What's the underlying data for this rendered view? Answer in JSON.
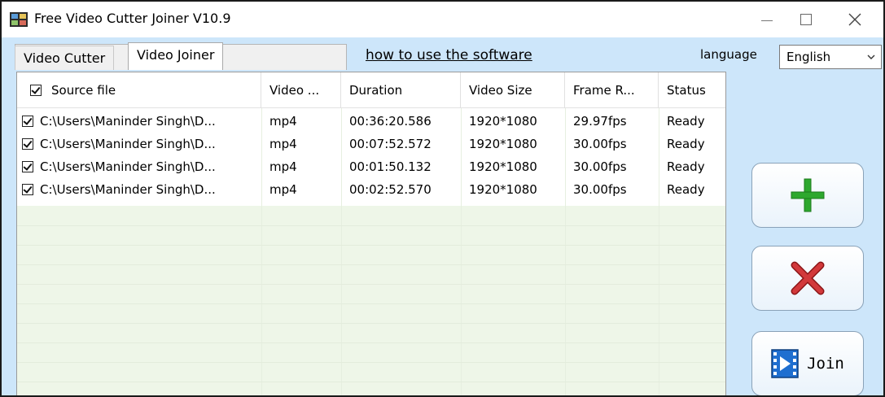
{
  "window": {
    "title": "Free Video Cutter Joiner V10.9",
    "controls": {
      "minimize": "—",
      "maximize": "☐",
      "close": "✕"
    }
  },
  "tabs": [
    {
      "label": "Video Cutter",
      "active": false
    },
    {
      "label": "Video Joiner",
      "active": true
    }
  ],
  "howto_link": "how to use the software",
  "language": {
    "label": "language",
    "selected": "English"
  },
  "table": {
    "columns": [
      "Source file",
      "Video ...",
      "Duration",
      "Video Size",
      "Frame R...",
      "Status"
    ],
    "header_checked": true,
    "rows": [
      {
        "checked": true,
        "source": "C:\\Users\\Maninder Singh\\D...",
        "format": "mp4",
        "duration": "00:36:20.586",
        "size": "1920*1080",
        "frame_rate": "29.97fps",
        "status": "Ready"
      },
      {
        "checked": true,
        "source": "C:\\Users\\Maninder Singh\\D...",
        "format": "mp4",
        "duration": "00:07:52.572",
        "size": "1920*1080",
        "frame_rate": "30.00fps",
        "status": "Ready"
      },
      {
        "checked": true,
        "source": "C:\\Users\\Maninder Singh\\D...",
        "format": "mp4",
        "duration": "00:01:50.132",
        "size": "1920*1080",
        "frame_rate": "30.00fps",
        "status": "Ready"
      },
      {
        "checked": true,
        "source": "C:\\Users\\Maninder Singh\\D...",
        "format": "mp4",
        "duration": "00:02:52.570",
        "size": "1920*1080",
        "frame_rate": "30.00fps",
        "status": "Ready"
      }
    ]
  },
  "buttons": {
    "add_icon": "plus-icon",
    "remove_icon": "x-icon",
    "join_icon": "film-play-icon",
    "join_label": "Join"
  },
  "colors": {
    "window_bg": "#cde6fa",
    "list_empty_bg": "#eef6e8",
    "add_green": "#2ea82e",
    "remove_red": "#c0282a",
    "join_blue": "#1f6fd0"
  }
}
